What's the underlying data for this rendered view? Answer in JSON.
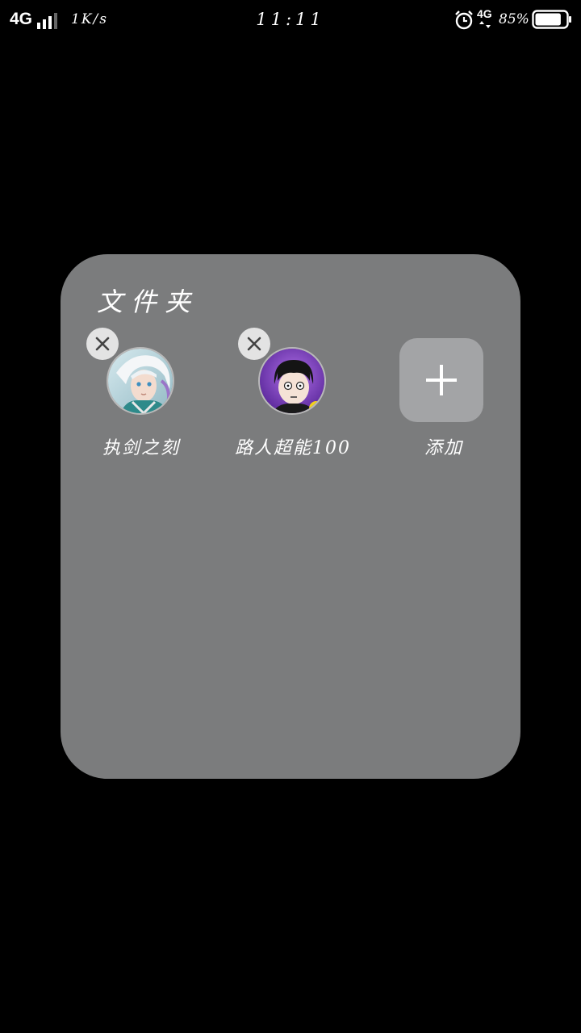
{
  "status_bar": {
    "network_left": "4G",
    "speed": "1K/s",
    "time": "11:11",
    "network_right": "4G",
    "battery_percent": "85%",
    "battery_level": 0.85,
    "icons": [
      "signal-bars-icon",
      "alarm-clock-icon",
      "data-arrows-icon",
      "battery-icon"
    ]
  },
  "folder": {
    "title": "文件夹",
    "apps": [
      {
        "label": "执剑之刻",
        "icon": "app-avatar-white-hair-icon",
        "removable": true
      },
      {
        "label": "路人超能100",
        "icon": "app-avatar-mob-icon",
        "removable": true
      }
    ],
    "add_label": "添加",
    "add_icon": "plus-icon",
    "remove_icon": "close-icon"
  },
  "colors": {
    "background": "#000000",
    "folder_bg": "#7b7c7d",
    "add_tile_bg": "#a3a4a6",
    "badge_bg": "#e3e3e3"
  }
}
